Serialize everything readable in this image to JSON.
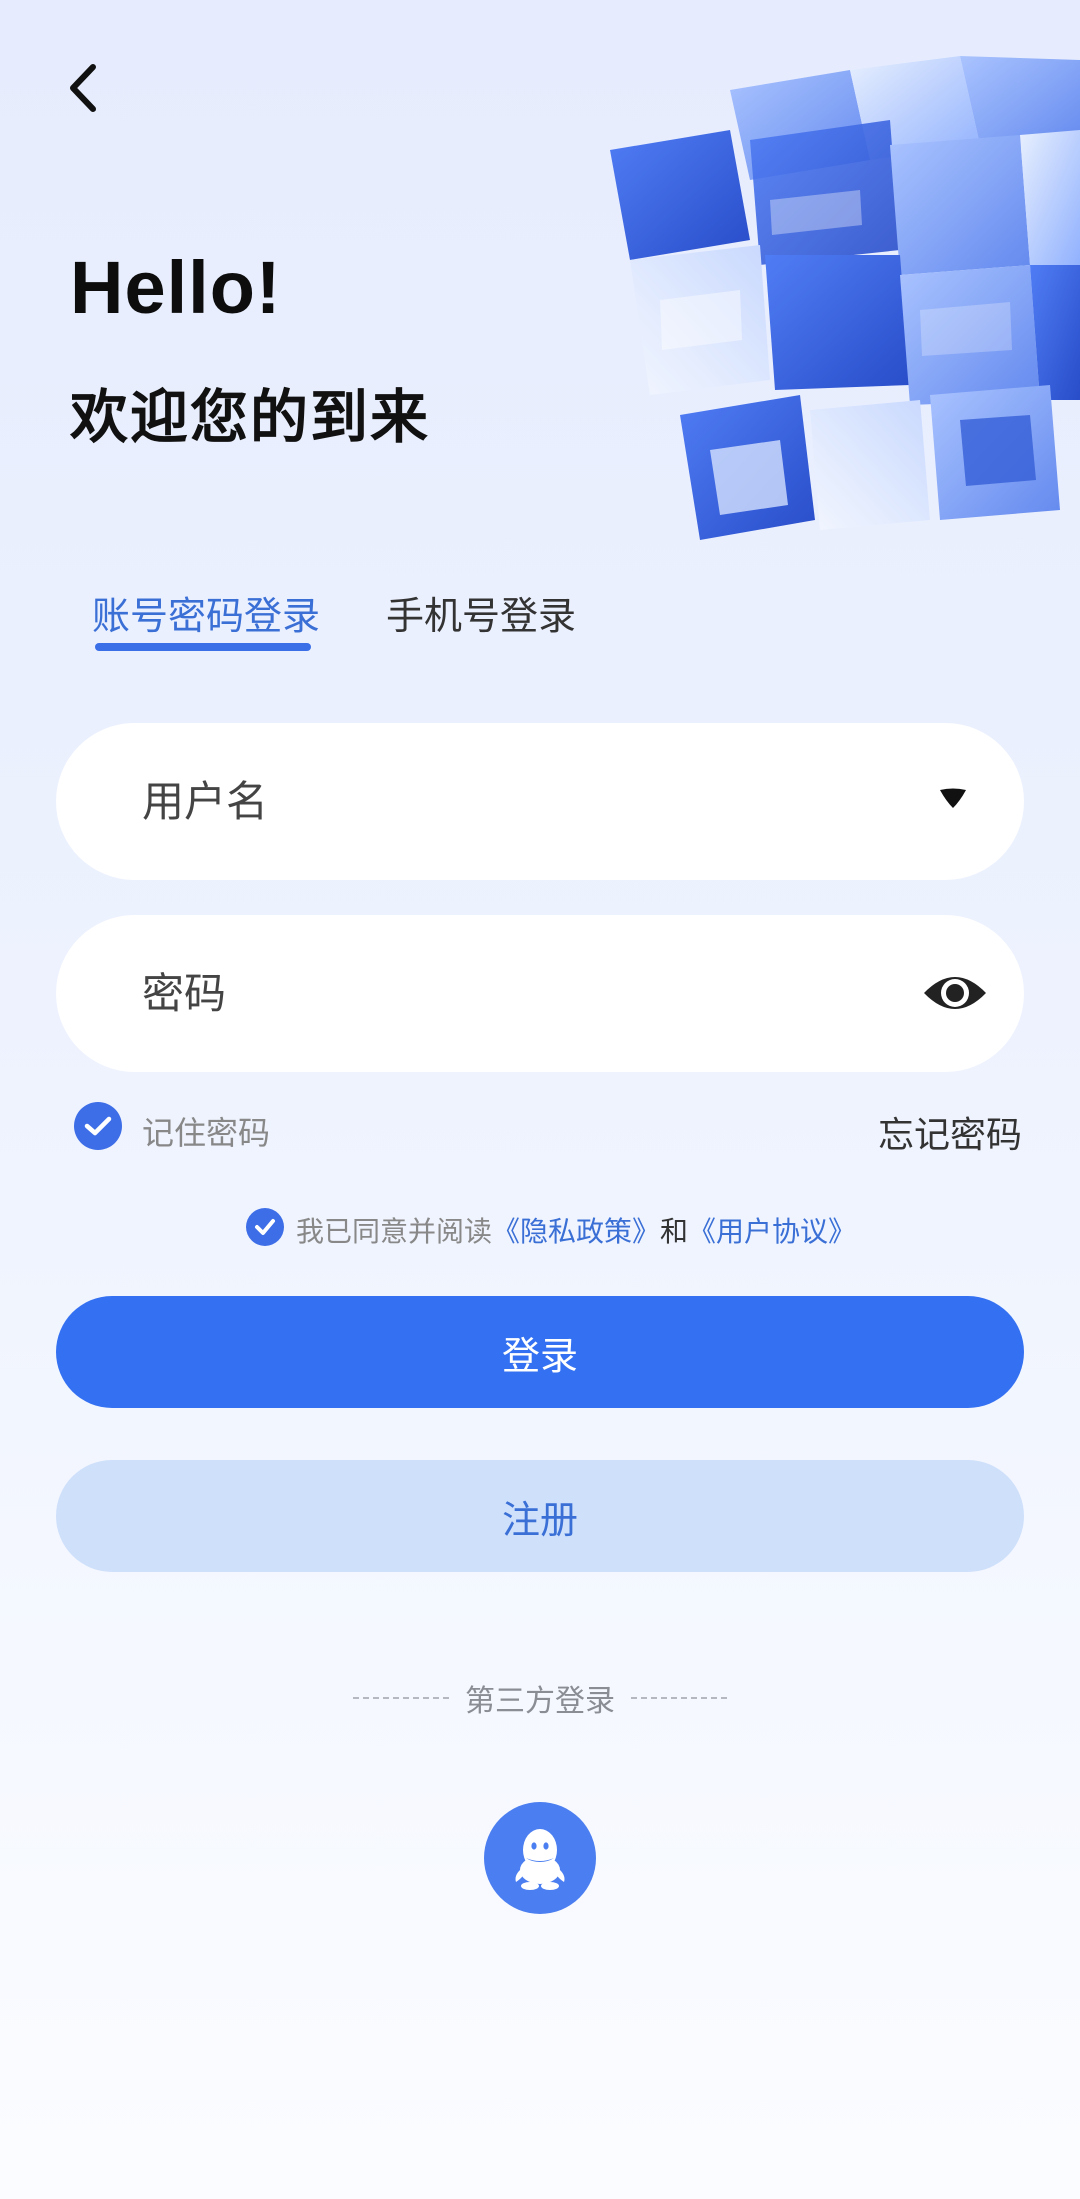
{
  "header": {
    "back_icon": "chevron-left-icon",
    "greeting": "Hello!",
    "welcome": "欢迎您的到来"
  },
  "tabs": [
    {
      "label": "账号密码登录",
      "active": true
    },
    {
      "label": "手机号登录",
      "active": false
    }
  ],
  "form": {
    "username": {
      "value": "",
      "placeholder": "用户名",
      "icon": "caret-down-icon"
    },
    "password": {
      "value": "",
      "placeholder": "密码",
      "icon": "eye-icon"
    },
    "remember": {
      "label": "记住密码",
      "checked": true
    },
    "forgot_label": "忘记密码"
  },
  "agreement": {
    "checked": true,
    "prefix": "我已同意并阅读",
    "privacy_link": "《隐私政策》",
    "and": "和",
    "terms_link": "《用户协议》"
  },
  "buttons": {
    "login": "登录",
    "register": "注册"
  },
  "third_party": {
    "label": "第三方登录",
    "providers": [
      "qq-icon"
    ]
  },
  "colors": {
    "accent": "#3471f2",
    "accent_text": "#3a6fd6",
    "register_bg": "#cfe0fb"
  }
}
